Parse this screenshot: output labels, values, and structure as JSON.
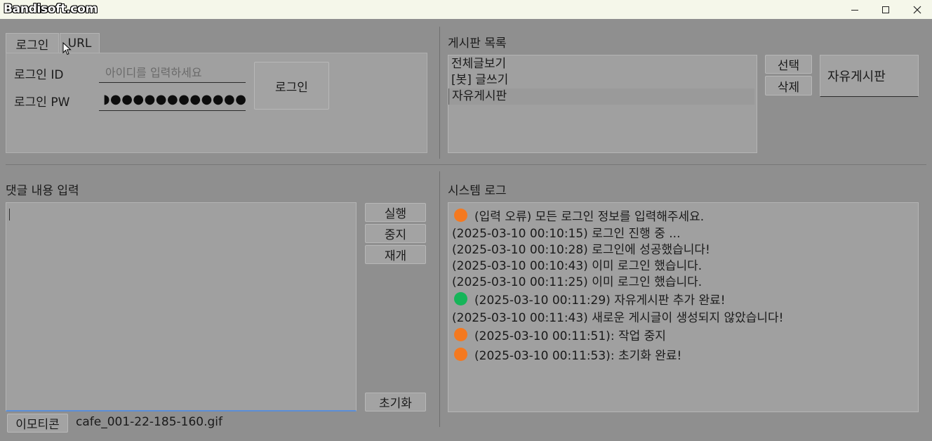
{
  "titlebar": {
    "logo_text": "Bandisoft.com",
    "minimize_glyph": "—",
    "maximize_glyph": "☐",
    "close_glyph": "✕"
  },
  "login_panel": {
    "tabs": [
      {
        "label": "로그인"
      },
      {
        "label": "URL"
      }
    ],
    "id_label": "로그인 ID",
    "id_placeholder": "아이디를 입력하세요",
    "pw_label": "로그인 PW",
    "pw_masked": "◗●●●●●●●●●●●●●",
    "login_button": "로그인"
  },
  "board_panel": {
    "title": "게시판 목록",
    "items": [
      {
        "label": "전체글보기"
      },
      {
        "label": "[봇] 글쓰기"
      },
      {
        "label": "자유게시판"
      }
    ],
    "selected_index": 2,
    "select_button": "선택",
    "delete_button": "삭제",
    "selected_board": "자유게시판"
  },
  "comment_panel": {
    "title": "댓글 내용 입력",
    "value": "",
    "run_button": "실행",
    "stop_button": "중지",
    "resume_button": "재개",
    "reset_button": "초기화",
    "emoticon_button": "이모티콘",
    "emoticon_file": "cafe_001-22-185-160.gif"
  },
  "log_panel": {
    "title": "시스템 로그",
    "entries": [
      {
        "dot": "#f47920",
        "text": "(입력 오류) 모든 로그인 정보를 입력해주세요."
      },
      {
        "dot": "",
        "text": "(2025-03-10 00:10:15) 로그인 진행 중 ..."
      },
      {
        "dot": "",
        "text": "(2025-03-10 00:10:28) 로그인에 성공했습니다!"
      },
      {
        "dot": "",
        "text": "(2025-03-10 00:10:43) 이미 로그인 했습니다."
      },
      {
        "dot": "",
        "text": "(2025-03-10 00:11:25) 이미 로그인 했습니다."
      },
      {
        "dot": "#16b559",
        "text": "(2025-03-10 00:11:29) 자유게시판 추가 완료!"
      },
      {
        "dot": "",
        "text": "(2025-03-10 00:11:43) 새로운 게시글이 생성되지 않았습니다!"
      },
      {
        "dot": "#f47920",
        "text": "(2025-03-10 00:11:51): 작업 중지"
      },
      {
        "dot": "#f47920",
        "text": "(2025-03-10 00:11:53): 초기화 완료!"
      }
    ]
  },
  "colors": {
    "orange_dot": "#f47920",
    "green_dot": "#16b559",
    "focus_accent": "#5b8ed6"
  }
}
